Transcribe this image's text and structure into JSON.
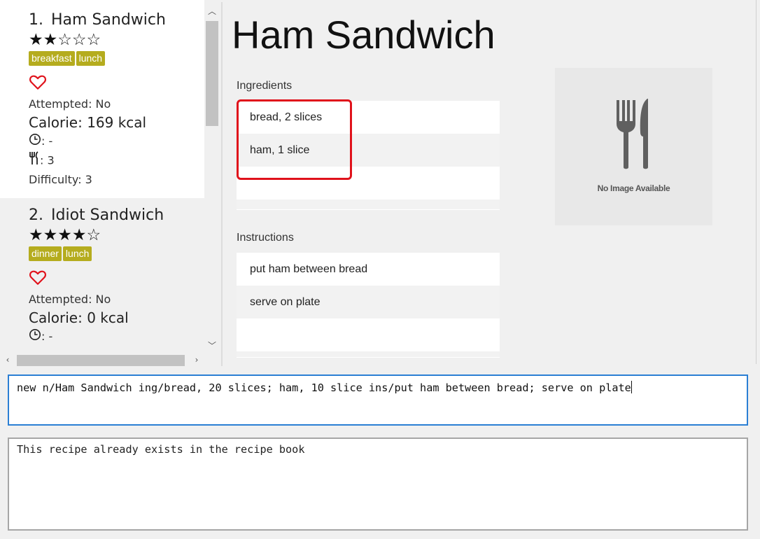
{
  "recipes": [
    {
      "index": "1.",
      "name": "Ham Sandwich",
      "rating": 2,
      "rating_max": 5,
      "stars": "★★☆☆☆",
      "tags": [
        "breakfast",
        "lunch"
      ],
      "favourite_icon": "heart-outline-icon",
      "attempted": "Attempted: No",
      "calorie": "Calorie: 169 kcal",
      "time_value": ": -",
      "servings_value": ": 3",
      "difficulty": "Difficulty: 3"
    },
    {
      "index": "2.",
      "name": "Idiot Sandwich",
      "rating": 4,
      "rating_max": 5,
      "stars": "★★★★☆",
      "tags": [
        "dinner",
        "lunch"
      ],
      "favourite_icon": "heart-outline-icon",
      "attempted": "Attempted: No",
      "calorie": "Calorie: 0 kcal",
      "time_value": ": -"
    }
  ],
  "detail": {
    "name": "Ham Sandwich",
    "ingredients_label": "Ingredients",
    "ingredients": [
      "bread, 2 slices",
      "ham, 1 slice"
    ],
    "instructions_label": "Instructions",
    "instructions": [
      "put ham between bread",
      "serve on plate"
    ],
    "image_placeholder": "No Image Available"
  },
  "command_box": {
    "value": "new n/Ham Sandwich ing/bread, 20 slices; ham, 10 slice ins/put ham between bread; serve on plate"
  },
  "result_box": {
    "value": "This recipe already exists in the recipe book"
  },
  "colors": {
    "tag": "#b5ac1e",
    "heart": "#e0121b",
    "annotation": "#e0121b",
    "command_border": "#2b7fd4"
  }
}
